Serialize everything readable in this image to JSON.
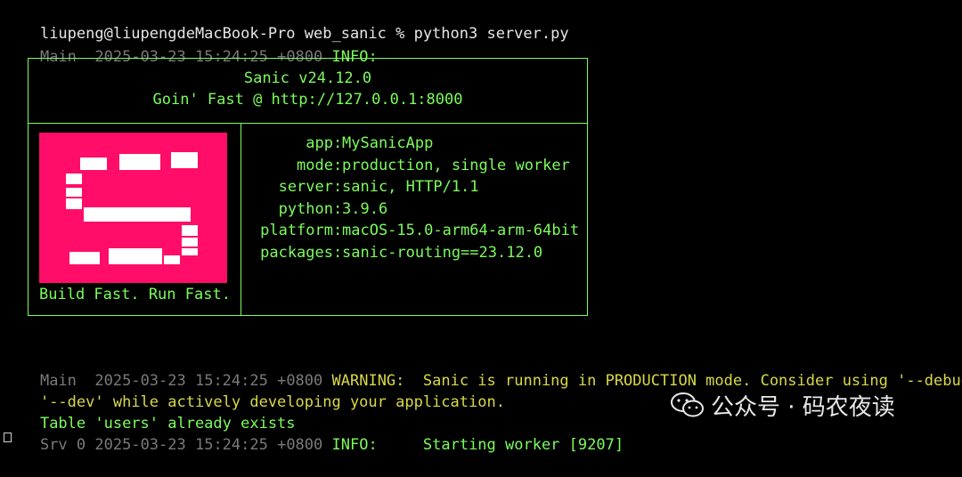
{
  "prompt_line": {
    "text": "liupeng@liupengdeMacBook-Pro web_sanic % python3 server.py"
  },
  "log1": {
    "source": "Main",
    "timestamp": "2025-03-23 15:24:25 +0800",
    "level": "INFO:"
  },
  "banner": {
    "title": "Sanic v24.12.0",
    "subtitle": "Goin' Fast @ http://127.0.0.1:8000",
    "tagline": "Build Fast. Run Fast.",
    "info": [
      {
        "key": "app",
        "value": "MySanicApp"
      },
      {
        "key": "mode",
        "value": "production, single worker"
      },
      {
        "key": "server",
        "value": "sanic, HTTP/1.1"
      },
      {
        "key": "python",
        "value": "3.9.6"
      },
      {
        "key": "platform",
        "value": "macOS-15.0-arm64-arm-64bit"
      },
      {
        "key": "packages",
        "value": "sanic-routing==23.12.0"
      }
    ],
    "logo_color": "#ff0d68"
  },
  "log2": {
    "source": "Main",
    "timestamp": "2025-03-23 15:24:25 +0800",
    "level": "WARNING:",
    "message": "Sanic is running in PRODUCTION mode. Consider using '--debug' or",
    "message_cont": "'--dev' while actively developing your application."
  },
  "plain_line": "Table 'users' already exists",
  "log3": {
    "source": "Srv 0",
    "timestamp": "2025-03-23 15:24:25 +0800",
    "level": "INFO:",
    "message": "Starting worker [9207]"
  },
  "watermark": {
    "text": "公众号 · 码农夜读",
    "icon": "wechat-icon"
  },
  "colors": {
    "green": "#7CFC5B",
    "yellow": "#d8d84a",
    "grey": "#7a7a7a",
    "background": "#000000"
  }
}
